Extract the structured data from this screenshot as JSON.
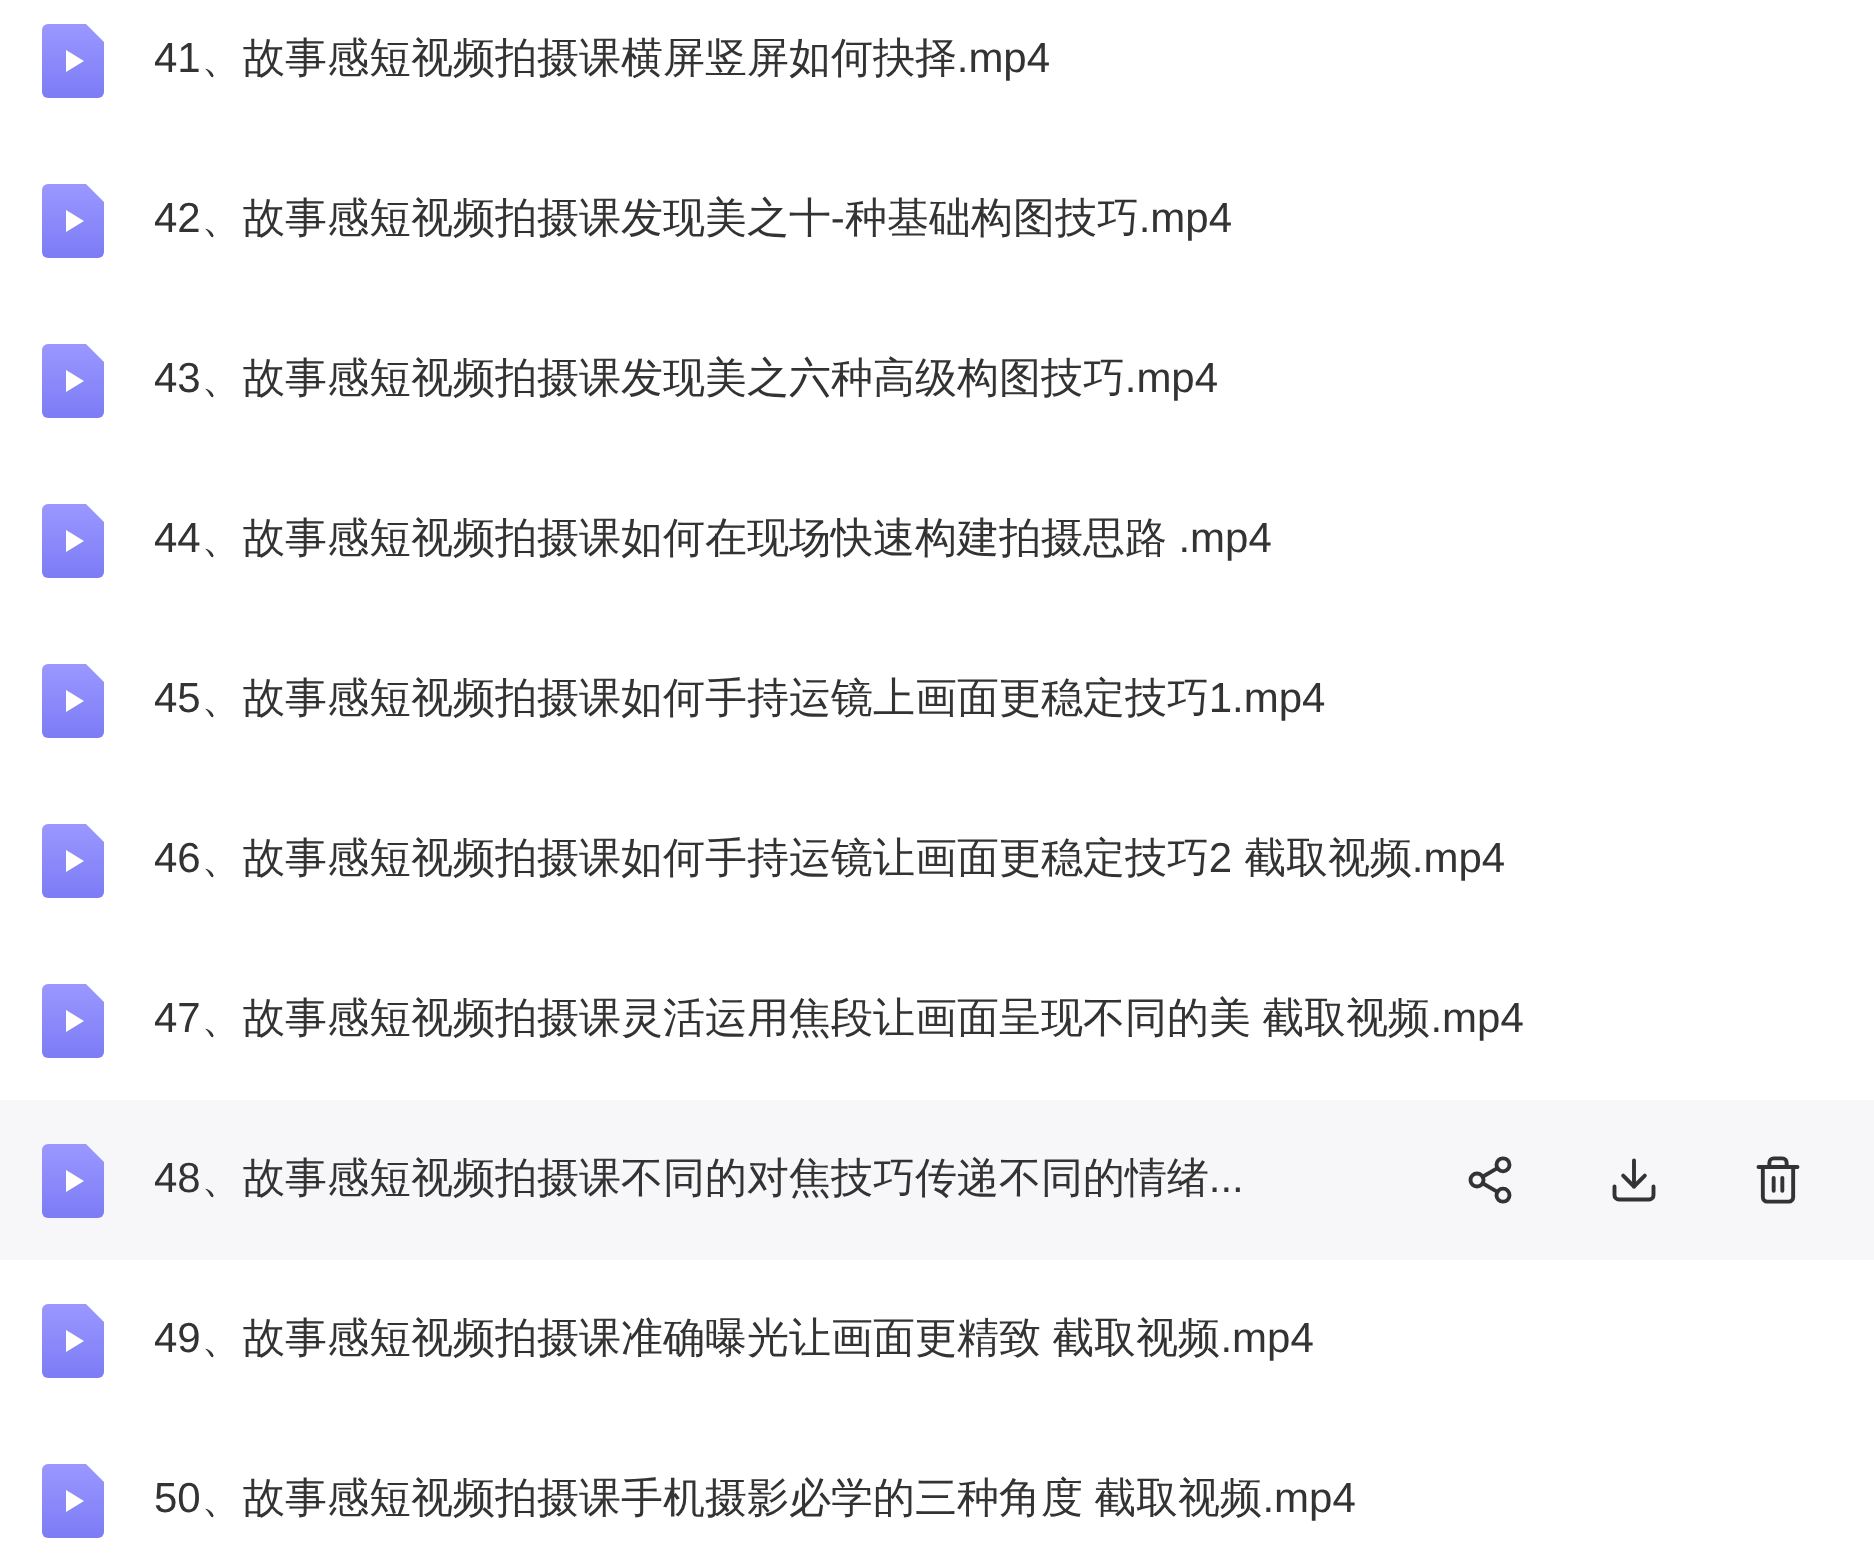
{
  "files": [
    {
      "name": "41、故事感短视频拍摄课横屏竖屏如何抉择.mp4",
      "hovered": false
    },
    {
      "name": "42、故事感短视频拍摄课发现美之十-种基础构图技巧.mp4",
      "hovered": false
    },
    {
      "name": "43、故事感短视频拍摄课发现美之六种高级构图技巧.mp4",
      "hovered": false
    },
    {
      "name": "44、故事感短视频拍摄课如何在现场快速构建拍摄思路 .mp4",
      "hovered": false
    },
    {
      "name": "45、故事感短视频拍摄课如何手持运镜上画面更稳定技巧1.mp4",
      "hovered": false
    },
    {
      "name": "46、故事感短视频拍摄课如何手持运镜让画面更稳定技巧2 截取视频.mp4",
      "hovered": false
    },
    {
      "name": "47、故事感短视频拍摄课灵活运用焦段让画面呈现不同的美 截取视频.mp4",
      "hovered": false
    },
    {
      "name": "48、故事感短视频拍摄课不同的对焦技巧传递不同的情绪...",
      "hovered": true
    },
    {
      "name": "49、故事感短视频拍摄课准确曝光让画面更精致 截取视频.mp4",
      "hovered": false
    },
    {
      "name": "50、故事感短视频拍摄课手机摄影必学的三种角度 截取视频.mp4",
      "hovered": false
    }
  ]
}
